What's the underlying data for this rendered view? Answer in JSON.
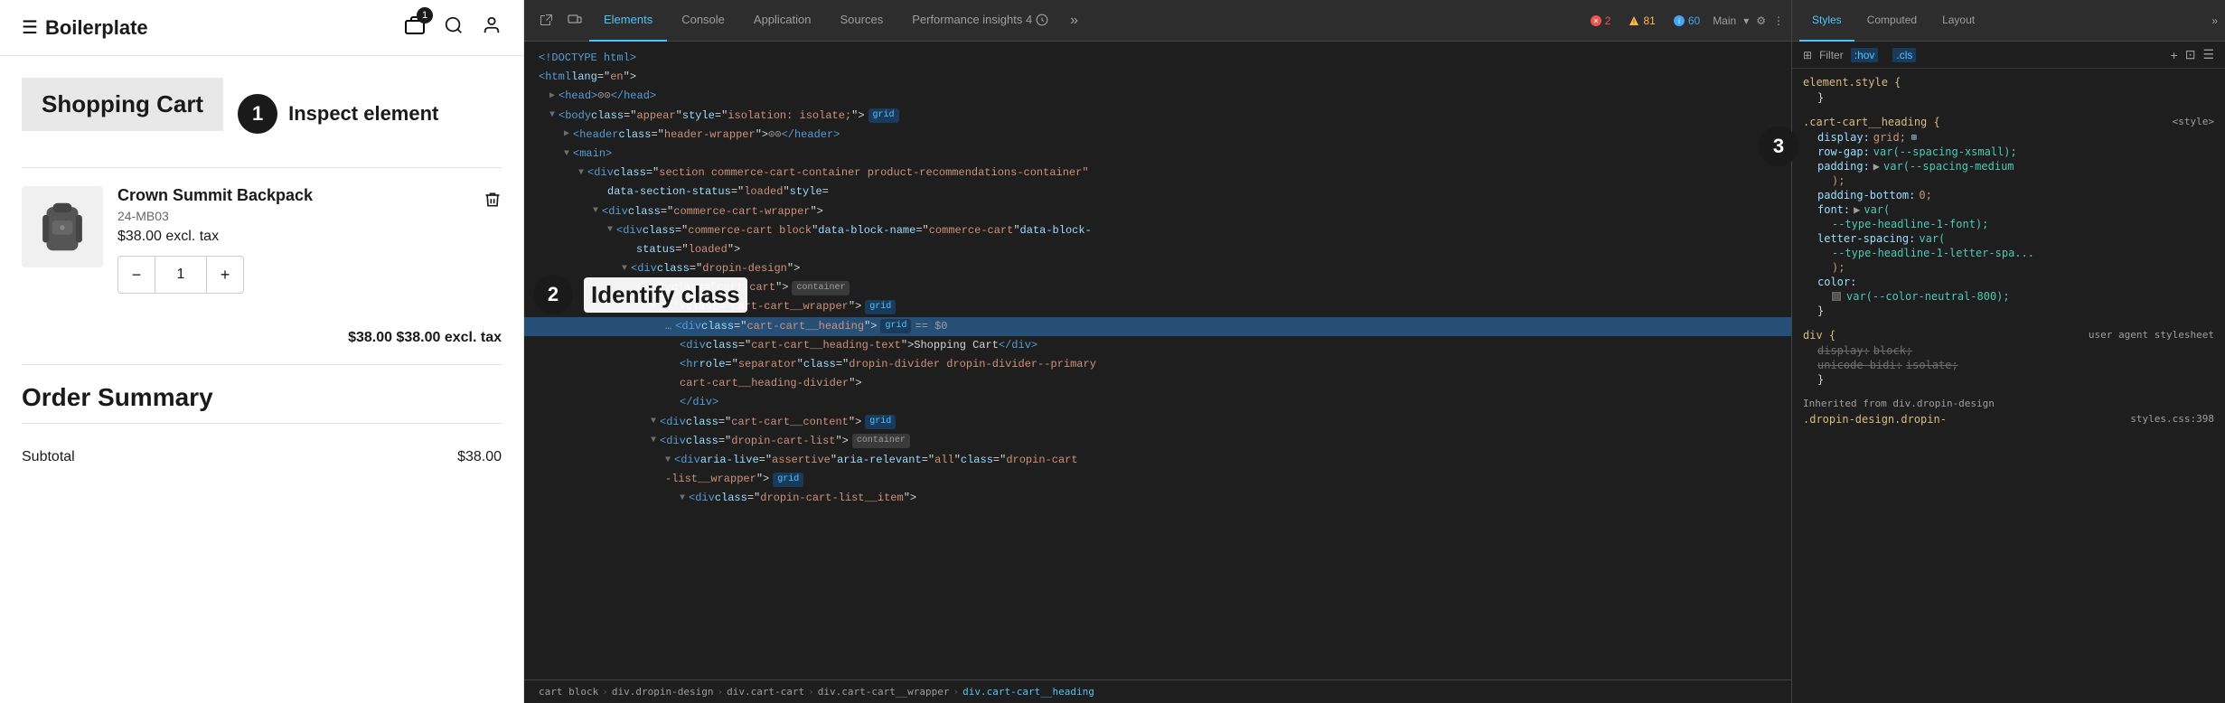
{
  "app": {
    "title": "Boilerplate",
    "cart_count": "1"
  },
  "callouts": [
    {
      "number": "1",
      "label": "Inspect element"
    },
    {
      "number": "2",
      "label": "Identify class"
    },
    {
      "number": "3"
    }
  ],
  "cart": {
    "title": "Shopping Cart",
    "item": {
      "name": "Crown Summit Backpack",
      "sku": "24-MB03",
      "price": "$38.00 excl. tax",
      "quantity": "1",
      "subtotal_line": "$38.00 $38.00 excl. tax"
    }
  },
  "order_summary": {
    "title": "Order Summary",
    "subtotal_label": "Subtotal",
    "subtotal_value": "$38.00"
  },
  "devtools": {
    "tabs": [
      "Elements",
      "Console",
      "Application",
      "Sources",
      "Performance insights 4"
    ],
    "active_tab": "Elements",
    "more_tabs": "»",
    "errors": {
      "red": "2",
      "yellow": "81",
      "blue": "60"
    },
    "profile": "Main",
    "html": [
      {
        "indent": 0,
        "content": "<!DOCTYPE html>"
      },
      {
        "indent": 0,
        "content": "<html lang=\"en\">"
      },
      {
        "indent": 1,
        "content": "▶ <head>⊙⊙ </head>"
      },
      {
        "indent": 1,
        "content": "▼ <body class=\"appear\" style=\"isolation: isolate;\">",
        "badge": "grid",
        "badge_type": "blue"
      },
      {
        "indent": 2,
        "content": "▶ <header class=\"header-wrapper\">⊙⊙ </header>"
      },
      {
        "indent": 2,
        "content": "▼ <main>"
      },
      {
        "indent": 3,
        "content": "▼ <div class=\"section commerce-cart-container product-recommendations-container\""
      },
      {
        "indent": 3,
        "content": "  data-section-status=\"loaded\" style="
      },
      {
        "indent": 4,
        "content": "▼ <div class=\"commerce-cart-wrapper\">"
      },
      {
        "indent": 5,
        "content": "▼ <div class=\"commerce-cart block\" data-block-name=\"commerce-cart\" data-block-",
        "dots": true
      },
      {
        "indent": 5,
        "content": "  status=\"loaded\">"
      },
      {
        "indent": 6,
        "content": "▼ <div class=\"dropin-design\">"
      },
      {
        "indent": 7,
        "content": "▼ <div class=\"cart-cart\">",
        "badge": "container"
      },
      {
        "indent": 8,
        "content": "▼ <div class=\"cart-cart__wrapper\">",
        "badge": "grid",
        "badge_type": "blue"
      },
      {
        "indent": 8,
        "content": "  … <div class=\"cart-cart__heading\">",
        "badge": "grid",
        "badge_type": "blue",
        "eq": "== $0",
        "selected": true
      },
      {
        "indent": 9,
        "content": "  <div class=\"cart-cart__heading-text\">Shopping Cart</div>"
      },
      {
        "indent": 9,
        "content": "  <hr role=\"separator\" class=\"dropin-divider dropin-divider--primary"
      },
      {
        "indent": 9,
        "content": "  cart-cart__heading-divider\">"
      },
      {
        "indent": 9,
        "content": "  </div>"
      },
      {
        "indent": 8,
        "content": "▼ <div class=\"cart-cart__content\">",
        "badge": "grid",
        "badge_type": "blue"
      },
      {
        "indent": 8,
        "content": "▼ <div class=\"dropin-cart-list\">",
        "badge": "container"
      },
      {
        "indent": 9,
        "content": "▼ <div aria-live=\"assertive\" aria-relevant=\"all\" class=\"dropin-cart"
      },
      {
        "indent": 9,
        "content": "-list__wrapper\">",
        "badge": "grid",
        "badge_type": "blue"
      },
      {
        "indent": 9,
        "content": "▼ <div class=\"dropin-cart-list__item\">"
      }
    ],
    "breadcrumb": [
      "cart block",
      "div.dropin-design",
      "div.cart-cart",
      "div.cart-cart__wrapper",
      "div.cart-cart__heading"
    ]
  },
  "styles": {
    "tabs": [
      "Styles",
      "Computed",
      "Layout"
    ],
    "active_tab": "Styles",
    "filter_placeholder": "Filter",
    "filter_tags": [
      ":hov",
      ".cls"
    ],
    "rules": [
      {
        "selector": "element.style {",
        "properties": [],
        "close": "}"
      },
      {
        "selector": ".cart-cart__heading {",
        "source": "<style>",
        "properties": [
          {
            "prop": "display:",
            "value": "grid;",
            "extra_icon": "grid"
          },
          {
            "prop": "row-gap:",
            "value": "var(--spacing-xsmall);"
          },
          {
            "prop": "padding:",
            "value": "▶ var(--spacing-medium"
          },
          {
            "prop": "",
            "value": ";"
          },
          {
            "prop": "padding-bottom:",
            "value": "0;"
          },
          {
            "prop": "font:",
            "value": "▶ var("
          },
          {
            "prop": "",
            "value": "--type-headline-1-font);"
          },
          {
            "prop": "letter-spacing:",
            "value": "var("
          },
          {
            "prop": "",
            "value": "--type-headline-1-letter-spa..."
          },
          {
            "prop": "",
            "value": ");"
          },
          {
            "prop": "color:",
            "value": ""
          }
        ],
        "color_swatch": true,
        "color_var": "var(--color-neutral-800);",
        "close": "}"
      },
      {
        "selector": "div {",
        "source": "user agent stylesheet",
        "properties": [
          {
            "prop": "display:",
            "value": "block;",
            "strikethrough": true
          },
          {
            "prop": "unicode-bidi:",
            "value": "isolate;",
            "strikethrough": true
          }
        ],
        "close": "}"
      },
      {
        "inherited_from": "Inherited from div.dropin-design",
        "selector": ".dropin-",
        "source": "styles.css:398",
        "selector_full": ".dropin-design.dropin-"
      }
    ]
  }
}
